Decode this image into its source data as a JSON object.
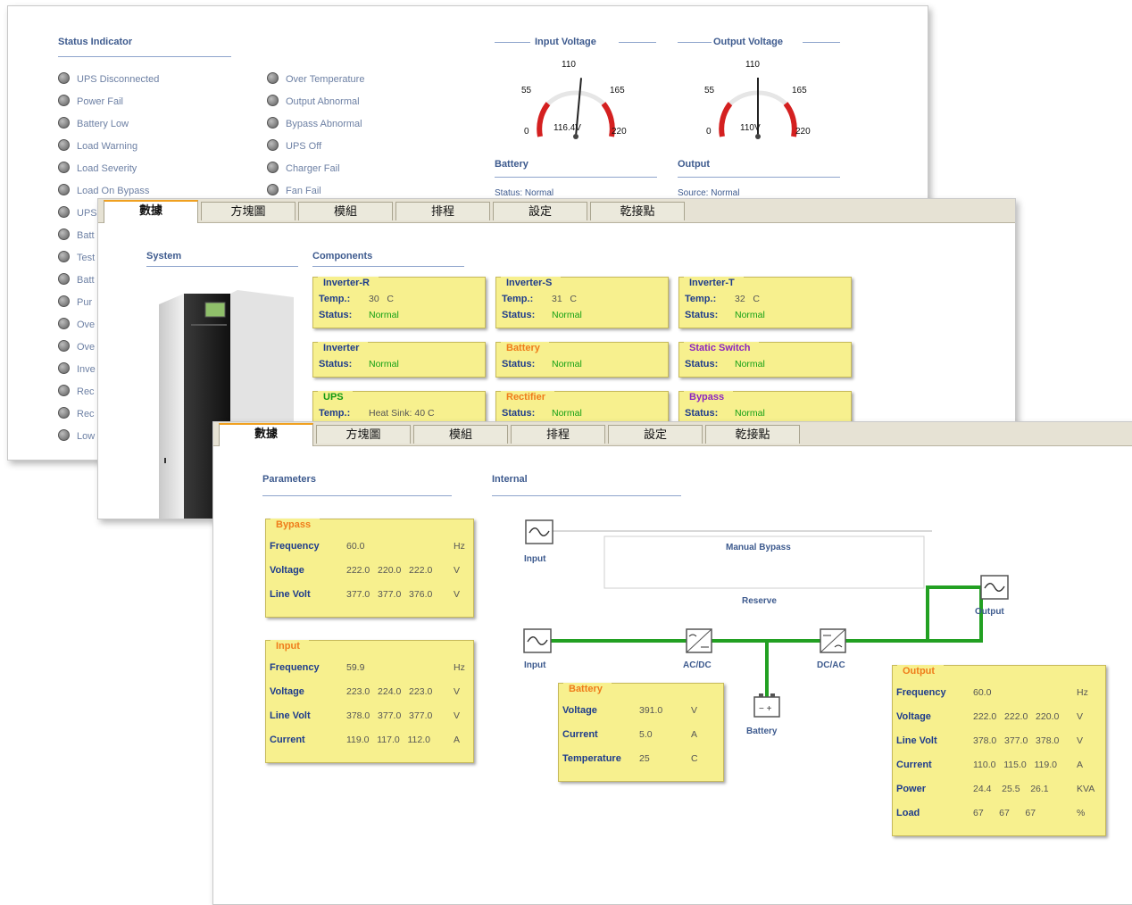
{
  "w1": {
    "status_title": "Status Indicator",
    "left_items": [
      "UPS Disconnected",
      "Power Fail",
      "Battery Low",
      "Load Warning",
      "Load Severity",
      "Load On Bypass",
      "UPS",
      "Batt",
      "Test",
      "Batt",
      "Pur",
      "Ove",
      "Ove",
      "Inve",
      "Rec",
      "Rec",
      "Low"
    ],
    "right_items": [
      "Over Temperature",
      "Output Abnormal",
      "Bypass Abnormal",
      "UPS Off",
      "Charger Fail",
      "Fan Fail"
    ],
    "input_gauge": {
      "title": "Input Voltage",
      "min": "0",
      "low": "55",
      "mid": "110",
      "high": "165",
      "max": "220",
      "reading": "116.4V",
      "value": 116.4
    },
    "output_gauge": {
      "title": "Output Voltage",
      "min": "0",
      "low": "55",
      "mid": "110",
      "high": "165",
      "max": "220",
      "reading": "110V",
      "value": 110
    },
    "battery_title": "Battery",
    "battery_status": "Status: Normal",
    "output_title": "Output",
    "output_source": "Source: Normal"
  },
  "tabs": [
    "數據",
    "方塊圖",
    "模組",
    "排程",
    "設定",
    "乾接點"
  ],
  "w2": {
    "system_title": "System",
    "components_title": "Components",
    "cards": [
      {
        "title": "Inverter-R",
        "rows": [
          [
            "Temp.:",
            "30   C",
            false
          ],
          [
            "Status:",
            "Normal",
            true
          ]
        ]
      },
      {
        "title": "Inverter-S",
        "rows": [
          [
            "Temp.:",
            "31   C",
            false
          ],
          [
            "Status:",
            "Normal",
            true
          ]
        ]
      },
      {
        "title": "Inverter-T",
        "rows": [
          [
            "Temp.:",
            "32   C",
            false
          ],
          [
            "Status:",
            "Normal",
            true
          ]
        ]
      },
      {
        "title": "Inverter",
        "rows": [
          [
            "Status:",
            "Normal",
            true
          ]
        ]
      },
      {
        "title": "Battery",
        "rows": [
          [
            "Status:",
            "Normal",
            true
          ]
        ]
      },
      {
        "title": "Static Switch",
        "rows": [
          [
            "Status:",
            "Normal",
            true
          ]
        ]
      },
      {
        "title": "UPS",
        "rows": [
          [
            "Temp.:",
            "Heat Sink: 40 C",
            false
          ]
        ]
      },
      {
        "title": "Rectifier",
        "rows": [
          [
            "Status:",
            "Normal",
            true
          ]
        ]
      },
      {
        "title": "Bypass",
        "rows": [
          [
            "Status:",
            "Normal",
            true
          ]
        ]
      }
    ]
  },
  "w3": {
    "params_title": "Parameters",
    "internal_title": "Internal",
    "bypass_card": {
      "title": "Bypass",
      "rows": [
        [
          "Frequency",
          "60.0",
          "Hz"
        ],
        [
          "Voltage",
          "222.0   220.0   222.0",
          "V"
        ],
        [
          "Line Volt",
          "377.0   377.0   376.0",
          "V"
        ]
      ]
    },
    "input_card": {
      "title": "Input",
      "rows": [
        [
          "Frequency",
          "59.9",
          "Hz"
        ],
        [
          "Voltage",
          "223.0   224.0   223.0",
          "V"
        ],
        [
          "Line Volt",
          "378.0   377.0   377.0",
          "V"
        ],
        [
          "Current",
          "119.0   117.0   112.0",
          "A"
        ]
      ]
    },
    "battery_card": {
      "title": "Battery",
      "rows": [
        [
          "Voltage",
          "391.0",
          "V"
        ],
        [
          "Current",
          "5.0",
          "A"
        ],
        [
          "Temperature",
          "25",
          "C"
        ]
      ]
    },
    "output_card": {
      "title": "Output",
      "rows": [
        [
          "Frequency",
          "60.0",
          "Hz"
        ],
        [
          "Voltage",
          "222.0   222.0   220.0",
          "V"
        ],
        [
          "Line Volt",
          "378.0   377.0   378.0",
          "V"
        ],
        [
          "Current",
          "110.0   115.0   119.0",
          "A"
        ],
        [
          "Power",
          "24.4    25.5    26.1",
          "KVA"
        ],
        [
          "Load",
          "67      67      67",
          "%"
        ]
      ]
    },
    "diagram": {
      "input_top": "Input",
      "manual_bypass": "Manual Bypass",
      "reserve": "Reserve",
      "output": "Output",
      "input": "Input",
      "acdc": "AC/DC",
      "dcac": "DC/AC",
      "battery": "Battery"
    }
  },
  "colors": {
    "accent_tab": "#f0a020",
    "card_bg": "#f7f08e",
    "flow_line": "#22a022",
    "gauge_red": "#d42020",
    "section_blue": "#3d5a8e"
  }
}
